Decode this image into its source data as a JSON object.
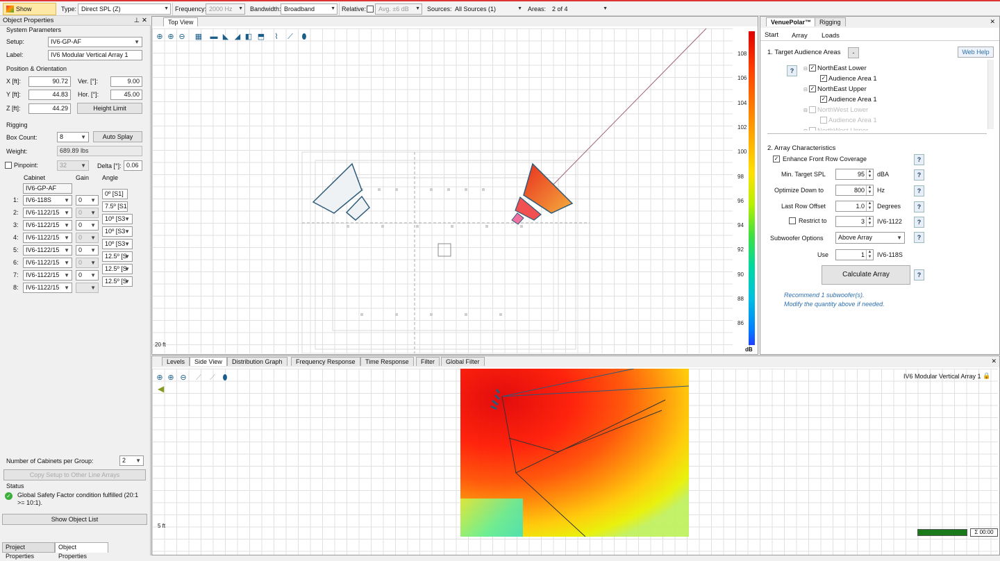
{
  "toolbar": {
    "show_mapping": "Show Mapping",
    "type_label": "Type:",
    "type_value": "Direct SPL (Z)",
    "frequency_label": "Frequency:",
    "frequency_value": "2000 Hz",
    "bandwidth_label": "Bandwidth:",
    "bandwidth_value": "Broadband",
    "relative_label": "Relative:",
    "relative_value": "Avg. ±6 dB",
    "sources_label": "Sources:",
    "sources_value": "All Sources (1)",
    "areas_label": "Areas:",
    "areas_value": "2 of 4"
  },
  "left_panel": {
    "title": "Object Properties",
    "system_parameters": "System Parameters",
    "setup_label": "Setup:",
    "setup_value": "IV6-GP-AF",
    "label_label": "Label:",
    "label_value": "IV6 Modular Vertical Array 1",
    "position_header": "Position & Orientation",
    "x_label": "X [ft]:",
    "x_value": "90.72",
    "y_label": "Y [ft]:",
    "y_value": "44.83",
    "z_label": "Z [ft]:",
    "z_value": "44.29",
    "ver_label": "Ver. [°]:",
    "ver_value": "9.00",
    "hor_label": "Hor. [°]:",
    "hor_value": "45.00",
    "height_limit": "Height Limit",
    "rigging_header": "Rigging",
    "box_count_label": "Box Count:",
    "box_count_value": "8",
    "auto_splay": "Auto Splay",
    "weight_label": "Weight:",
    "weight_value": "689.89 lbs",
    "pinpoint_label": "Pinpoint:",
    "pinpoint_value": "32",
    "delta_label": "Delta [°]:",
    "delta_value": "0.06",
    "col_cabinet": "Cabinet",
    "col_gain": "Gain",
    "col_angle": "Angle",
    "grid_label": "IV6-GP-AF",
    "cabinets": [
      {
        "num": "1:",
        "cabinet": "IV6-118S",
        "gain": "0",
        "angle": "0º [S1]",
        "gain_enabled": true
      },
      {
        "num": "2:",
        "cabinet": "IV6-1122/15",
        "gain": "0",
        "angle": "7.5º [S1]",
        "gain_enabled": false
      },
      {
        "num": "3:",
        "cabinet": "IV6-1122/15",
        "gain": "0",
        "angle": "10º [S3",
        "gain_enabled": true
      },
      {
        "num": "4:",
        "cabinet": "IV6-1122/15",
        "gain": "0",
        "angle": "10º [S3",
        "gain_enabled": false
      },
      {
        "num": "5:",
        "cabinet": "IV6-1122/15",
        "gain": "0",
        "angle": "10º [S3",
        "gain_enabled": true
      },
      {
        "num": "6:",
        "cabinet": "IV6-1122/15",
        "gain": "0",
        "angle": "12.5º [S",
        "gain_enabled": false
      },
      {
        "num": "7:",
        "cabinet": "IV6-1122/15",
        "gain": "0",
        "angle": "12.5º [S",
        "gain_enabled": true
      },
      {
        "num": "8:",
        "cabinet": "IV6-1122/15",
        "gain": "",
        "angle": "12.5º [S",
        "gain_enabled": false
      }
    ],
    "cabinets_per_group_label": "Number of Cabinets per Group:",
    "cabinets_per_group_value": "2",
    "copy_setup": "Copy Setup to Other Line Arrays",
    "status_header": "Status",
    "status_text": "Global Safety Factor condition fulfilled (20:1 >= 10:1).",
    "show_object_list": "Show Object List",
    "tab_project": "Project Properties",
    "tab_object": "Object Properties"
  },
  "top_view": {
    "tab": "Top View",
    "scale": "20 ft",
    "colorbar_ticks": [
      "108",
      "106",
      "104",
      "102",
      "100",
      "98",
      "96",
      "94",
      "92",
      "90",
      "88",
      "86"
    ],
    "colorbar_unit": "dB"
  },
  "right_panel": {
    "tab_venuepolar": "VenuePolar™",
    "tab_rigging": "Rigging",
    "subtab_start": "Start",
    "subtab_array": "Array",
    "subtab_loads": "Loads",
    "section1": "1. Target Audience Areas",
    "minus_btn": "-",
    "web_help": "Web Help",
    "help_glyph": "?",
    "tree": [
      {
        "label": "NorthEast Lower",
        "checked": true,
        "level": 0,
        "enabled": true
      },
      {
        "label": "Audience Area 1",
        "checked": true,
        "level": 1,
        "enabled": true
      },
      {
        "label": "NorthEast Upper",
        "checked": true,
        "level": 0,
        "enabled": true
      },
      {
        "label": "Audience Area 1",
        "checked": true,
        "level": 1,
        "enabled": true
      },
      {
        "label": "NorthWest Lower",
        "checked": false,
        "level": 0,
        "enabled": false
      },
      {
        "label": "Audience Area 1",
        "checked": false,
        "level": 1,
        "enabled": false
      },
      {
        "label": "NorthWest Upper",
        "checked": false,
        "level": 0,
        "enabled": false
      }
    ],
    "section2": "2. Array Characteristics",
    "enhance_label": "Enhance Front Row Coverage",
    "min_spl_label": "Min. Target SPL",
    "min_spl_value": "95",
    "min_spl_unit": "dBA",
    "optimize_label": "Optimize Down to",
    "optimize_value": "800",
    "optimize_unit": "Hz",
    "last_row_label": "Last Row Offset",
    "last_row_value": "1.0",
    "last_row_unit": "Degrees",
    "restrict_label": "Restrict to",
    "restrict_value": "3",
    "restrict_unit": "IV6-1122",
    "sub_opts_label": "Subwoofer Options",
    "sub_opts_value": "Above Array",
    "use_label": "Use",
    "use_value": "1",
    "use_unit": "IV6-118S",
    "calculate": "Calculate Array",
    "recommend_line1": "Recommend 1 subwoofer(s).",
    "recommend_line2": "Modify the quantity above if needed."
  },
  "bottom_view": {
    "tabs": [
      "Levels",
      "Side View",
      "Distribution Graph",
      "Frequency Response",
      "Time Response",
      "Filter",
      "Global Filter"
    ],
    "active_tab": "Side View",
    "array_label": "IV6 Modular Vertical Array 1",
    "scale": "5 ft",
    "timer": "Σ 00:00"
  },
  "colors": {
    "accent_red": "#d33333",
    "hot_red": "#e00000",
    "array_teal": "#2d5a78",
    "help_blue": "#2a6fb0"
  }
}
